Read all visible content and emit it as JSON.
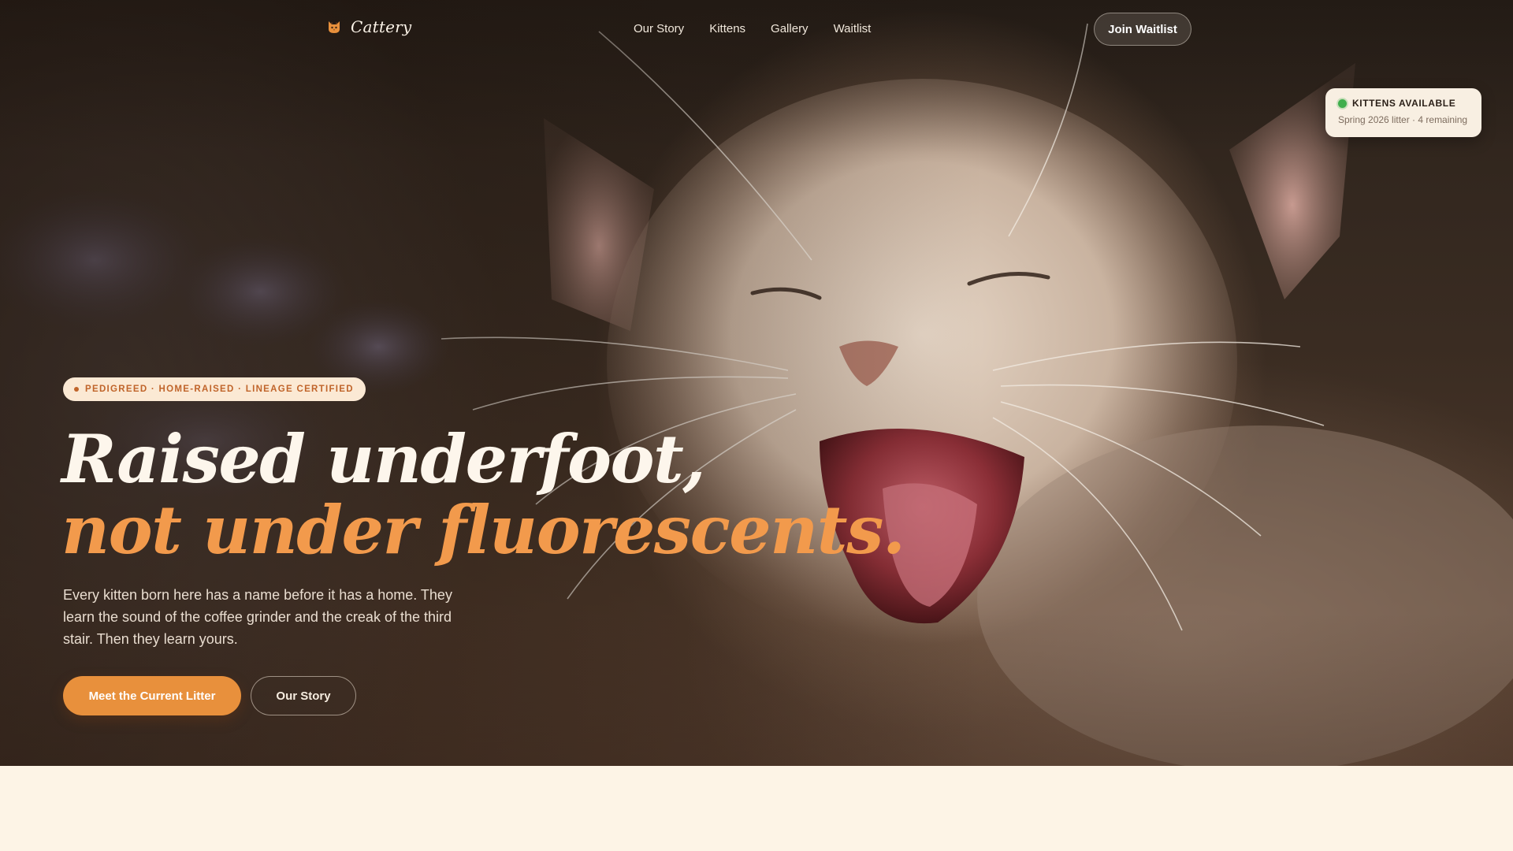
{
  "brand": {
    "name": "Cattery",
    "icon": "cat-face-icon"
  },
  "nav": {
    "links": [
      "Our Story",
      "Kittens",
      "Gallery",
      "Waitlist"
    ],
    "join_label": "Join Waitlist"
  },
  "availability": {
    "title": "KITTENS AVAILABLE",
    "subtitle": "Spring 2026 litter · 4 remaining",
    "status_color": "#3fae4c"
  },
  "hero": {
    "badge": "PEDIGREED · HOME-RAISED · LINEAGE CERTIFIED",
    "headline_line1": "Raised underfoot,",
    "headline_line2": "not under fluorescents.",
    "lede": "Every kitten born here has a name before it has a home. They learn the sound of the coffee grinder and the creak of the third stair. Then they learn yours.",
    "primary_cta": "Meet the Current Litter",
    "secondary_cta": "Our Story"
  },
  "colors": {
    "accent": "#e8903c",
    "headline_accent": "#f29a4c",
    "cream": "#fdf4e6",
    "badge_text": "#c0642a"
  }
}
